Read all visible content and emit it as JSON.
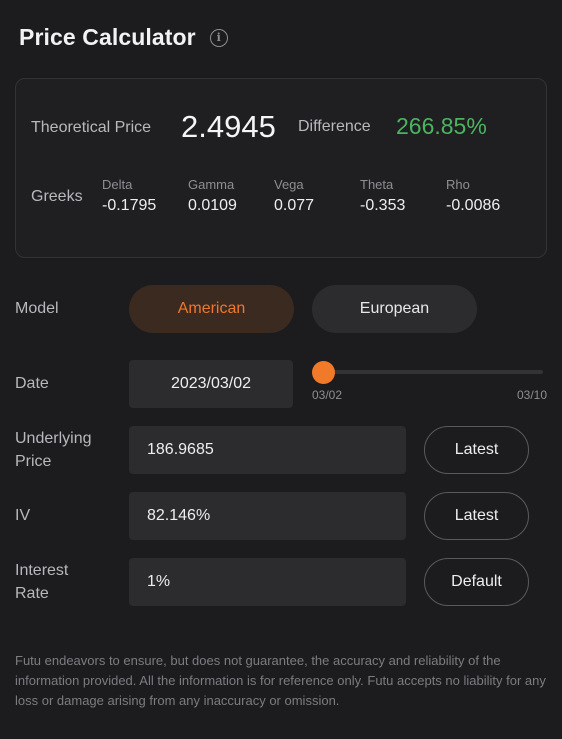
{
  "header": {
    "title": "Price Calculator",
    "info_icon": "info-icon"
  },
  "summary": {
    "theoretical_price_label": "Theoretical Price",
    "theoretical_price_value": "2.4945",
    "difference_label": "Difference",
    "difference_value": "266.85%",
    "difference_color": "#4cb460",
    "greeks_label": "Greeks",
    "greeks": [
      {
        "name": "Delta",
        "value": "-0.1795"
      },
      {
        "name": "Gamma",
        "value": "0.0109"
      },
      {
        "name": "Vega",
        "value": "0.077"
      },
      {
        "name": "Theta",
        "value": "-0.353"
      },
      {
        "name": "Rho",
        "value": "-0.0086"
      }
    ]
  },
  "model": {
    "label": "Model",
    "options": [
      "American",
      "European"
    ],
    "selected": "American",
    "accent": "#f07a2a"
  },
  "date": {
    "label": "Date",
    "value": "2023/03/02",
    "slider_min": "03/02",
    "slider_max": "03/10",
    "slider_position": 0
  },
  "underlying": {
    "label_line1": "Underlying",
    "label_line2": "Price",
    "value": "186.9685",
    "button": "Latest"
  },
  "iv": {
    "label": "IV",
    "value": "82.146%",
    "button": "Latest"
  },
  "interest": {
    "label_line1": "Interest",
    "label_line2": "Rate",
    "value": "1%",
    "button": "Default"
  },
  "disclaimer": "Futu endeavors to ensure, but does not guarantee, the accuracy and reliability of the information provided. All the information is for reference only. Futu accepts no liability for any loss or damage arising from any inaccuracy or omission."
}
